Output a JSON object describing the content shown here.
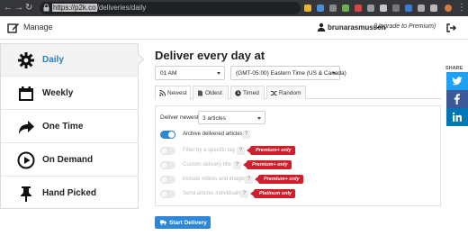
{
  "browser": {
    "url_host": "https://p2k.co",
    "url_path": "/deliveries/daily"
  },
  "header": {
    "manage_label": "Manage",
    "user_name": "brunarasmussen",
    "upgrade_label": "(Upgrade to Premium)"
  },
  "sidebar": {
    "items": [
      {
        "label": "Daily",
        "icon": "gear-icon",
        "active": true
      },
      {
        "label": "Weekly",
        "icon": "calendar-icon",
        "active": false
      },
      {
        "label": "One Time",
        "icon": "share-arrow-icon",
        "active": false
      },
      {
        "label": "On Demand",
        "icon": "play-icon",
        "active": false
      },
      {
        "label": "Hand Picked",
        "icon": "pushpin-icon",
        "active": false
      }
    ]
  },
  "main": {
    "title": "Deliver every day at",
    "time_select": "01 AM",
    "timezone_select": "(GMT-05:00) Eastern Time (US & Canada)",
    "tabs": [
      {
        "label": "Newest",
        "icon": "rss-icon",
        "active": true
      },
      {
        "label": "Oldest",
        "icon": "document-icon",
        "active": false
      },
      {
        "label": "Timed",
        "icon": "clock-icon",
        "active": false
      },
      {
        "label": "Random",
        "icon": "shuffle-icon",
        "active": false
      }
    ],
    "deliver_newest_label": "Deliver newest",
    "article_count": "3 articles",
    "options": [
      {
        "label": "Archive delivered articles",
        "enabled": true,
        "on": true,
        "badge": ""
      },
      {
        "label": "Filter by a specific tag",
        "enabled": false,
        "on": false,
        "badge": "Premium+ only"
      },
      {
        "label": "Custom delivery title",
        "enabled": false,
        "on": false,
        "badge": "Premium+ only"
      },
      {
        "label": "Include videos and images",
        "enabled": false,
        "on": false,
        "badge": "Premium+ only"
      },
      {
        "label": "Send articles individually",
        "enabled": false,
        "on": false,
        "badge": "Platinum only"
      }
    ],
    "help_mark": "?",
    "start_button": "Start Delivery"
  },
  "share": {
    "label": "SHARE",
    "buttons": [
      {
        "icon": "twitter-icon",
        "color": "#1da1f2"
      },
      {
        "icon": "facebook-icon",
        "color": "#3b5998"
      },
      {
        "icon": "linkedin-icon",
        "color": "#0077b5"
      }
    ]
  },
  "colors": {
    "accent": "#2f86d6",
    "badge": "#cf1f2a",
    "active_label": "#2a7fbf"
  }
}
